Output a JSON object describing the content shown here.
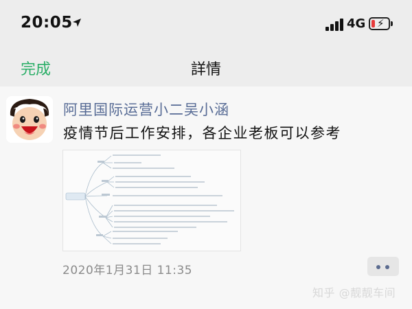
{
  "status": {
    "time": "20:05",
    "network": "4G",
    "location_icon": "location-arrow-icon",
    "signal_icon": "signal-bars-icon",
    "battery_icon": "battery-low-charging-icon",
    "battery_color": "#e63a3a"
  },
  "nav": {
    "done_label": "完成",
    "title": "詳情",
    "accent_color": "#2aae67"
  },
  "post": {
    "username": "阿里国际运营小二吴小涵",
    "username_color": "#576b95",
    "text": "疫情节后工作安排，各企业老板可以参考",
    "image_icon": "mind-map-image",
    "timestamp": "2020年1月31日 11:35",
    "more_icon": "more-dots-icon"
  },
  "watermark": "知乎 @靓靓车间"
}
